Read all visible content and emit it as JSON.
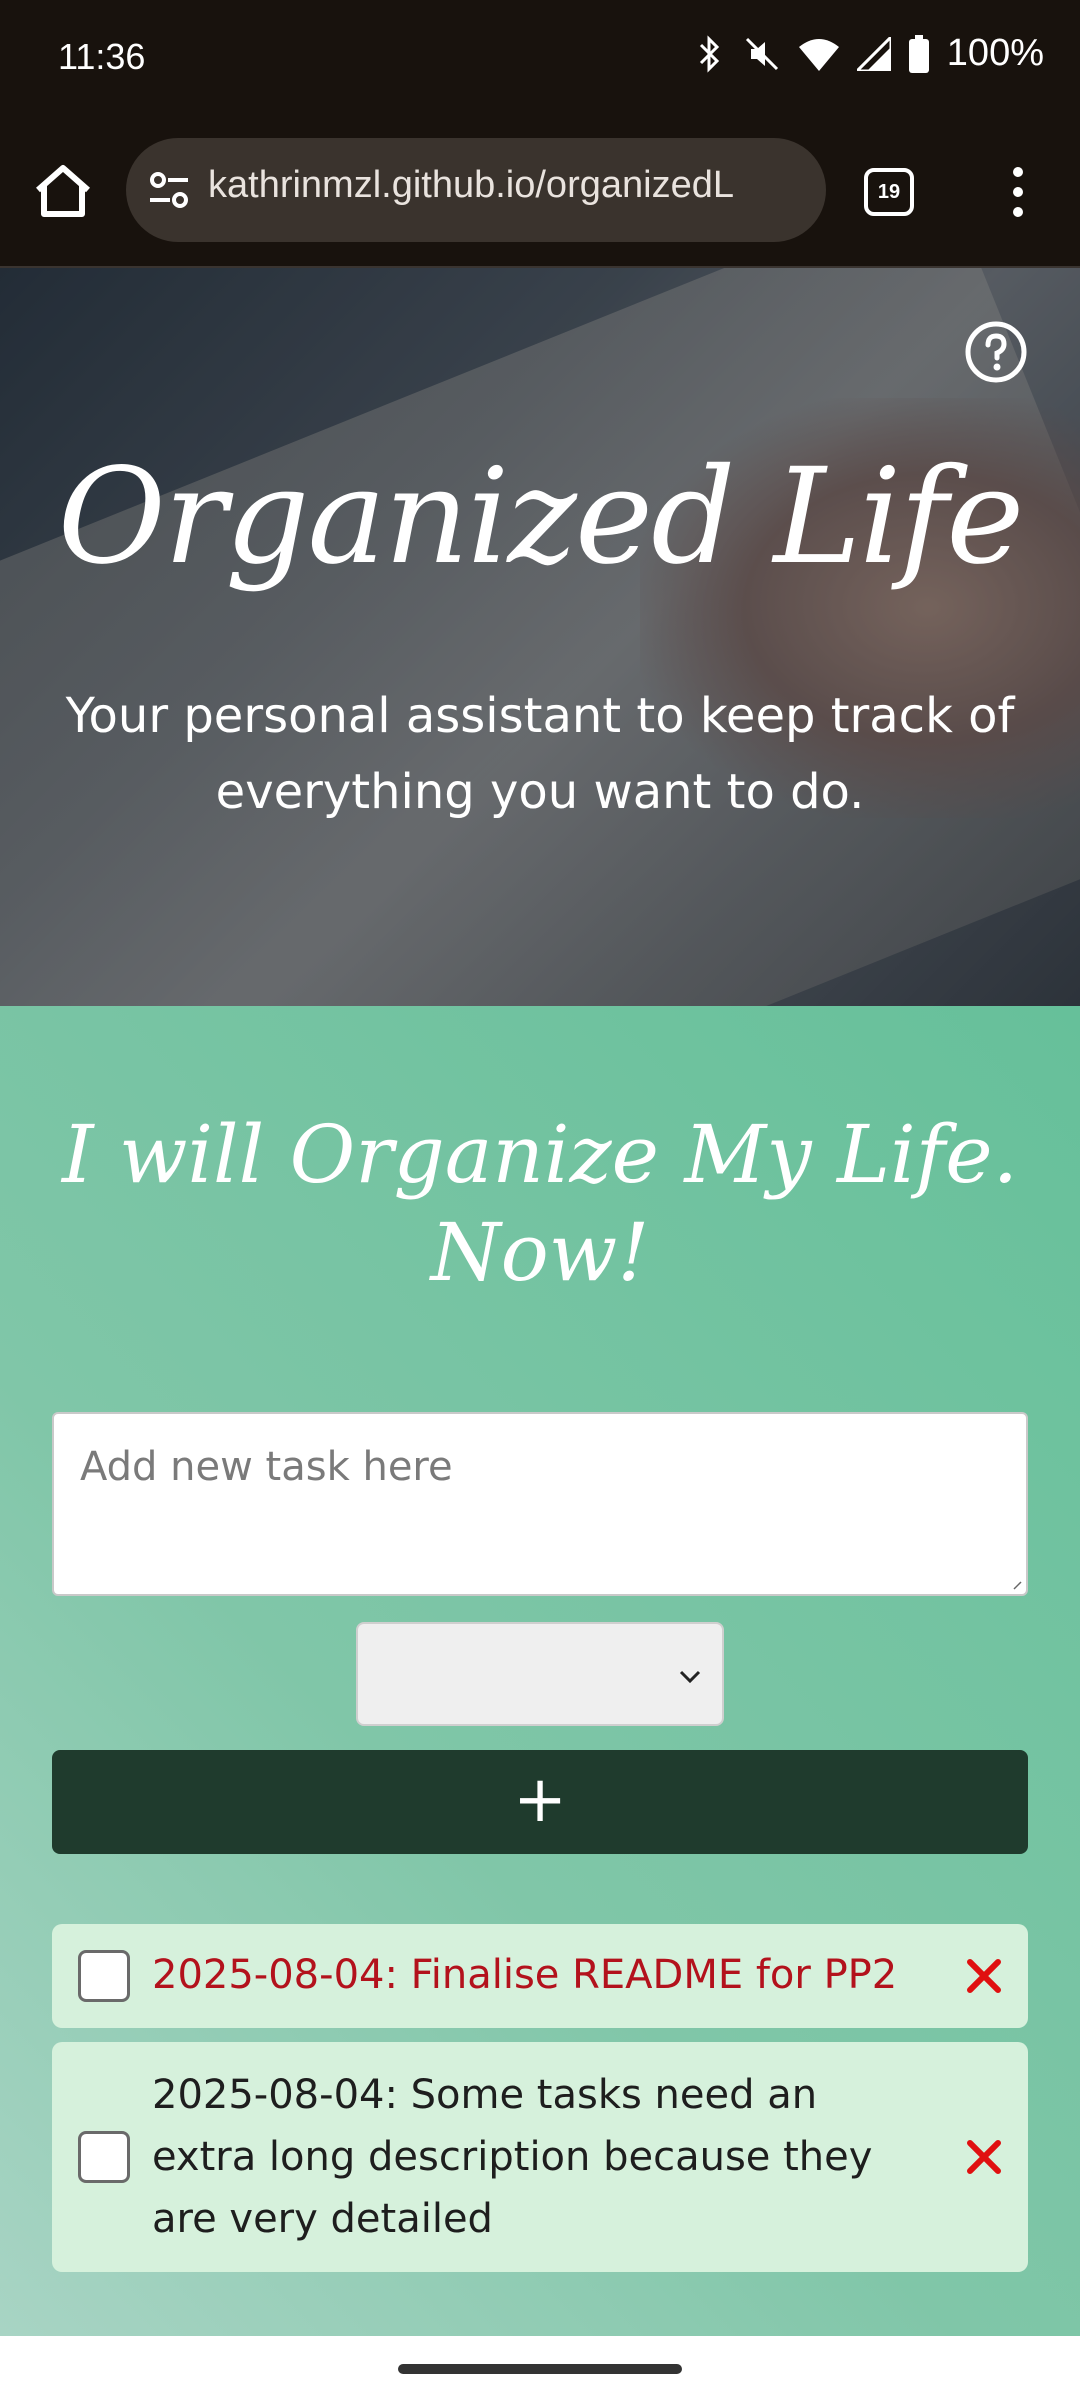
{
  "status_bar": {
    "time": "11:36",
    "battery": "100%"
  },
  "browser": {
    "url": "kathrinmzl.github.io/organizedL",
    "tab_count": "19"
  },
  "hero": {
    "title": "Organized Life",
    "subtitle": "Your personal assistant to keep track of everything you want to do."
  },
  "main": {
    "title": "I will Organize My Life. Now!",
    "input_placeholder": "Add new task here",
    "select_value": "",
    "add_label": "+"
  },
  "tasks": [
    {
      "text": "2025-08-04: Finalise README for PP2",
      "overdue": true,
      "checked": false
    },
    {
      "text": "2025-08-04: Some tasks need an extra long description because they are very detailed",
      "overdue": false,
      "checked": false
    }
  ],
  "colors": {
    "accent_dark": "#1f3b2d",
    "overdue_text": "#b3121c",
    "task_bg": "#d6f1dc",
    "delete": "#e01010"
  }
}
